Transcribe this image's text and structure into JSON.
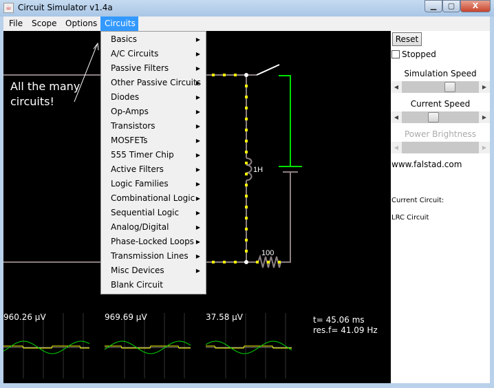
{
  "window": {
    "title": "Circuit Simulator v1.4a",
    "minimize": "▁",
    "maximize": "▢",
    "close": "X"
  },
  "menubar": [
    "File",
    "Scope",
    "Options",
    "Circuits"
  ],
  "circuits_menu": [
    "Basics",
    "A/C Circuits",
    "Passive Filters",
    "Other Passive Circuits",
    "Diodes",
    "Op-Amps",
    "Transistors",
    "MOSFETs",
    "555 Timer Chip",
    "Active Filters",
    "Logic Families",
    "Combinational Logic",
    "Sequential Logic",
    "Analog/Digital",
    "Phase-Locked Loops",
    "Transmission Lines",
    "Misc Devices",
    "Blank Circuit"
  ],
  "annotation": {
    "line1": "All the many",
    "line2": "circuits!"
  },
  "circuit": {
    "inductor_label": "1H",
    "resistor_label": "100"
  },
  "scopes": [
    {
      "value": "960.26 µV"
    },
    {
      "value": "969.69 µV"
    },
    {
      "value": "37.58 µV"
    }
  ],
  "info": {
    "time": "t= 45.06 ms",
    "resf": "res.f= 41.09 Hz"
  },
  "side": {
    "reset": "Reset",
    "stopped": "Stopped",
    "stopped_checked": false,
    "sim_speed": "Simulation Speed",
    "sim_speed_value": 0.65,
    "current_speed": "Current Speed",
    "current_speed_value": 0.4,
    "power_brightness": "Power Brightness",
    "url": "www.falstad.com",
    "current_circuit_label": "Current Circuit:",
    "current_circuit": "LRC Circuit"
  },
  "colors": {
    "menu_highlight": "#3399ff",
    "wire": "#8c8080",
    "current_dot": "#ffff00",
    "voltage_high": "#00e000"
  }
}
